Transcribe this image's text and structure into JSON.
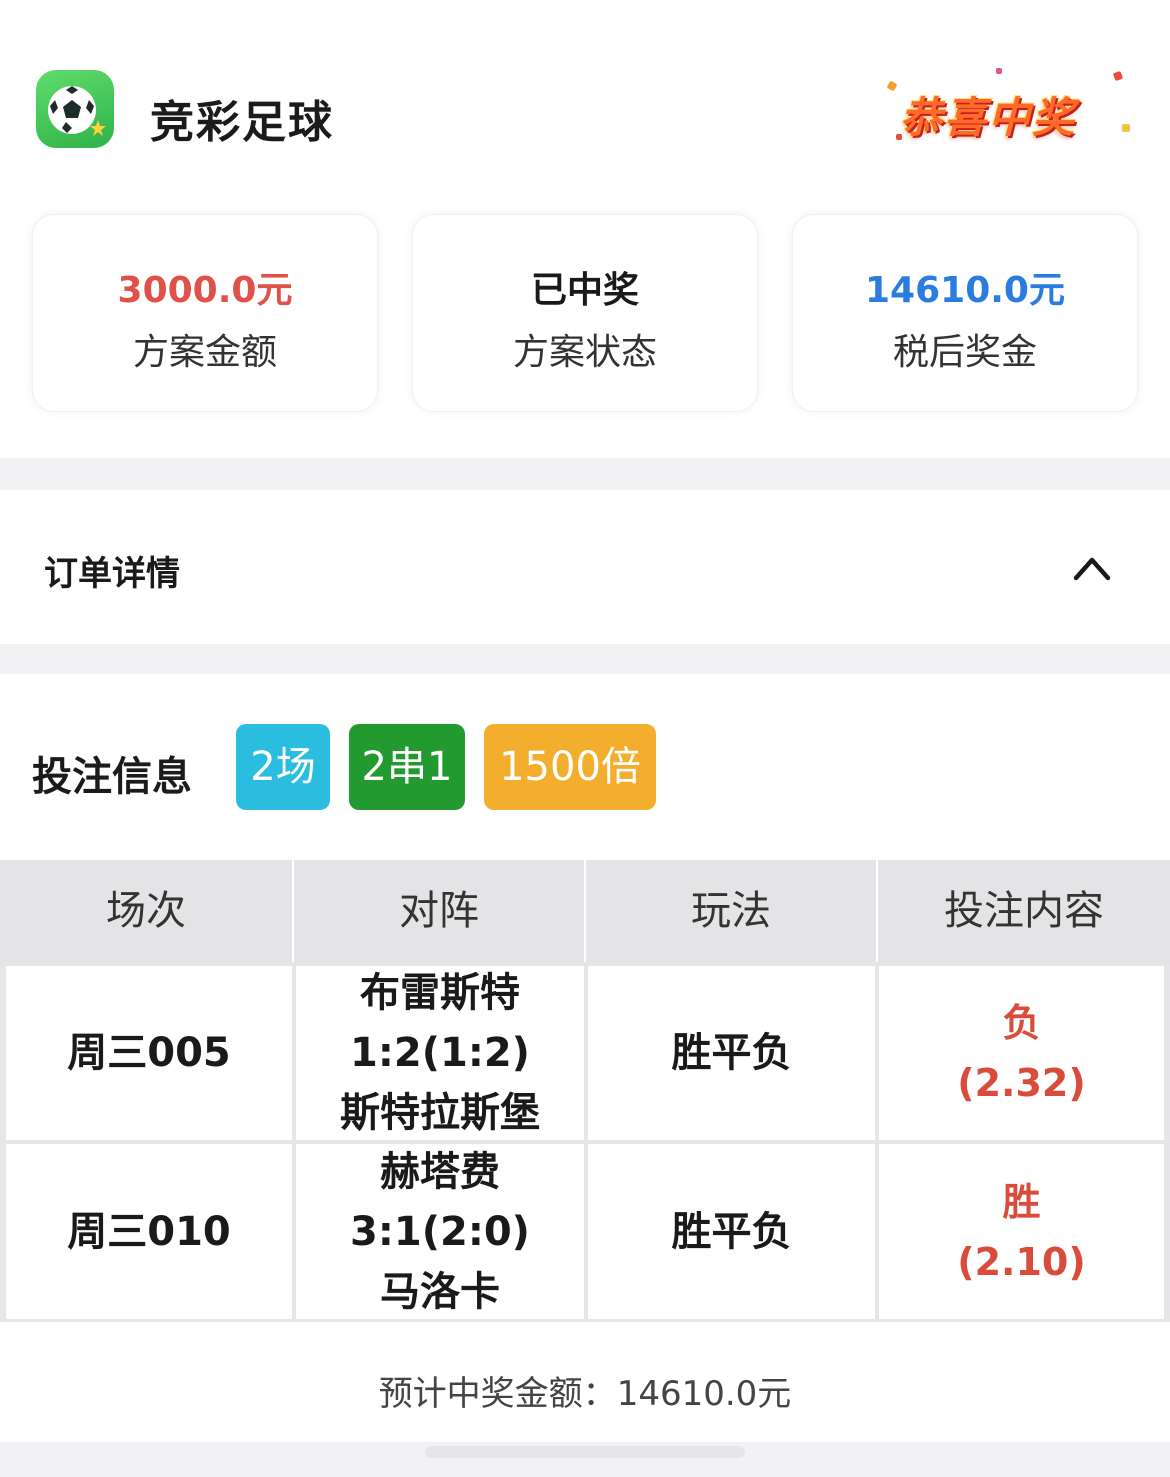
{
  "header": {
    "app_title": "竞彩足球",
    "win_badge": "恭喜中奖"
  },
  "stats": [
    {
      "value": "3000.0元",
      "label": "方案金额",
      "color": "#e0514a"
    },
    {
      "value": "已中奖",
      "label": "方案状态",
      "color": "#1a1a1a"
    },
    {
      "value": "14610.0元",
      "label": "税后奖金",
      "color": "#2a7ce0"
    }
  ],
  "order": {
    "title": "订单详情"
  },
  "bet_info": {
    "title": "投注信息",
    "tags": [
      {
        "text": "2场",
        "color": "#2bbde0"
      },
      {
        "text": "2串1",
        "color": "#229a2f"
      },
      {
        "text": "1500倍",
        "color": "#f3ae2e"
      }
    ]
  },
  "table": {
    "headers": [
      "场次",
      "对阵",
      "玩法",
      "投注内容"
    ],
    "rows": [
      {
        "match": "周三005",
        "home": "布雷斯特",
        "score": "1:2(1:2)",
        "away": "斯特拉斯堡",
        "play": "胜平负",
        "pick": "负",
        "odds": "(2.32)"
      },
      {
        "match": "周三010",
        "home": "赫塔费",
        "score": "3:1(2:0)",
        "away": "马洛卡",
        "play": "胜平负",
        "pick": "胜",
        "odds": "(2.10)"
      }
    ]
  },
  "footer": {
    "label": "预计中奖金额：",
    "amount": "14610.0元"
  }
}
